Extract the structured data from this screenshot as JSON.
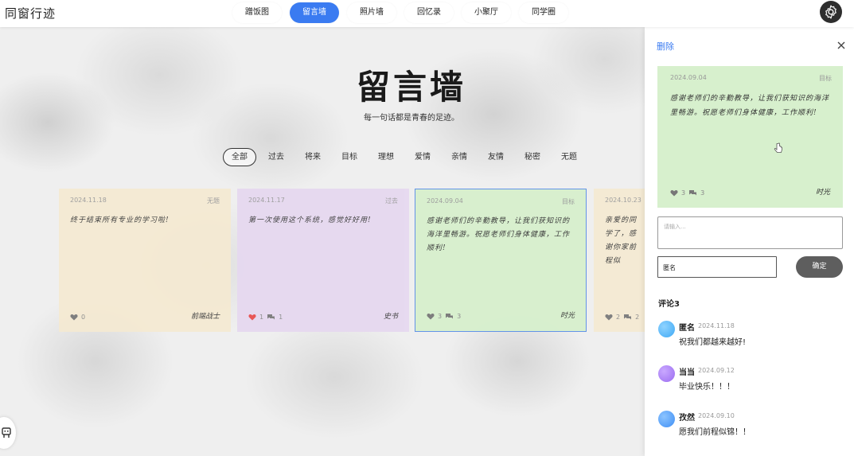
{
  "app": {
    "title": "同窗行迹"
  },
  "nav": [
    {
      "label": "蹭饭图",
      "active": false
    },
    {
      "label": "留言墙",
      "active": true
    },
    {
      "label": "照片墙",
      "active": false
    },
    {
      "label": "回忆录",
      "active": false
    },
    {
      "label": "小聚厅",
      "active": false
    },
    {
      "label": "同学圈",
      "active": false
    }
  ],
  "main": {
    "title": "留言墙",
    "subtitle": "每一句话都是青春的足迹。",
    "filters": [
      "全部",
      "过去",
      "将来",
      "目标",
      "理想",
      "爱情",
      "亲情",
      "友情",
      "秘密",
      "无题"
    ],
    "active_filter": "全部"
  },
  "cards": [
    {
      "date": "2024.11.18",
      "tag": "无题",
      "message": "终于结束所有专业的学习啦!",
      "likes": "0",
      "comments": "",
      "author": "前端战士",
      "color": "#f5ead2",
      "liked": false
    },
    {
      "date": "2024.11.17",
      "tag": "过去",
      "message": "第一次使用这个系统，感觉好好用!",
      "likes": "1",
      "comments": "1",
      "author": "史书",
      "color": "#e6d8f0",
      "liked": true
    },
    {
      "date": "2024.09.04",
      "tag": "目标",
      "message": "感谢老师们的辛勤教导，让我们获知识的海洋里畅游。祝愿老师们身体健康，工作顺利!",
      "likes": "3",
      "comments": "3",
      "author": "时光",
      "color": "#d7f0cd",
      "liked": false
    },
    {
      "date": "2024.10.23",
      "tag": "",
      "message": "亲爱的同学了，感谢你家前程似",
      "likes": "2",
      "comments": "2",
      "author": "",
      "color": "#f5ead2",
      "liked": false
    }
  ],
  "panel": {
    "delete_label": "删除",
    "card": {
      "date": "2024.09.04",
      "tag": "目标",
      "message": "感谢老师们的辛勤教导，让我们获知识的海洋里畅游。祝愿老师们身体健康，工作顺利!",
      "likes": "3",
      "comments": "3",
      "author": "时光"
    },
    "comment_placeholder": "请输入...",
    "name_value": "匿名",
    "confirm_label": "确定",
    "comment_count_label": "评论3",
    "comments": [
      {
        "name": "匿名",
        "date": "2024.11.18",
        "text": "祝我们都越来越好!",
        "color": "#3fa9f5"
      },
      {
        "name": "当当",
        "date": "2024.09.12",
        "text": "毕业快乐！！！",
        "color": "#9b6cf0"
      },
      {
        "name": "孜然",
        "date": "2024.09.10",
        "text": "愿我们前程似锦！！",
        "color": "#3f8ff5"
      }
    ]
  },
  "colors": {
    "accent": "#3a7bf1",
    "heart_red": "#e84b4b",
    "panel_card": "#d7f0cd"
  }
}
